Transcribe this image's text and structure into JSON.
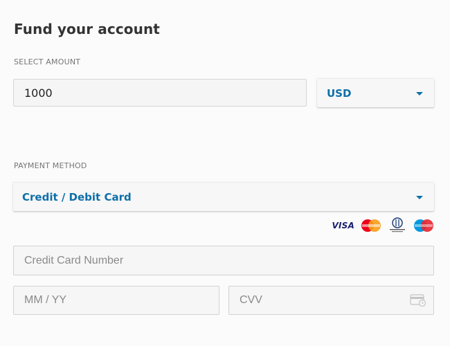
{
  "page": {
    "title": "Fund your account"
  },
  "amount": {
    "label": "SELECT AMOUNT",
    "value": "1000",
    "currency": "USD"
  },
  "payment": {
    "label": "PAYMENT METHOD",
    "method": "Credit / Debit Card",
    "accepted_cards": [
      "VISA",
      "MasterCard",
      "Diners Club International",
      "Maestro"
    ],
    "visa_text": "VISA"
  },
  "card_form": {
    "number_placeholder": "Credit Card Number",
    "expiry_placeholder": "MM / YY",
    "cvv_placeholder": "CVV"
  },
  "colors": {
    "accent": "#0e6fa9",
    "mastercard_red": "#eb001b",
    "mastercard_orange": "#f79e1b",
    "maestro_blue": "#0099df",
    "maestro_red": "#e8232e"
  },
  "icons": {
    "select_caret": "caret-down-icon",
    "cvv": "card-cvv-icon"
  }
}
